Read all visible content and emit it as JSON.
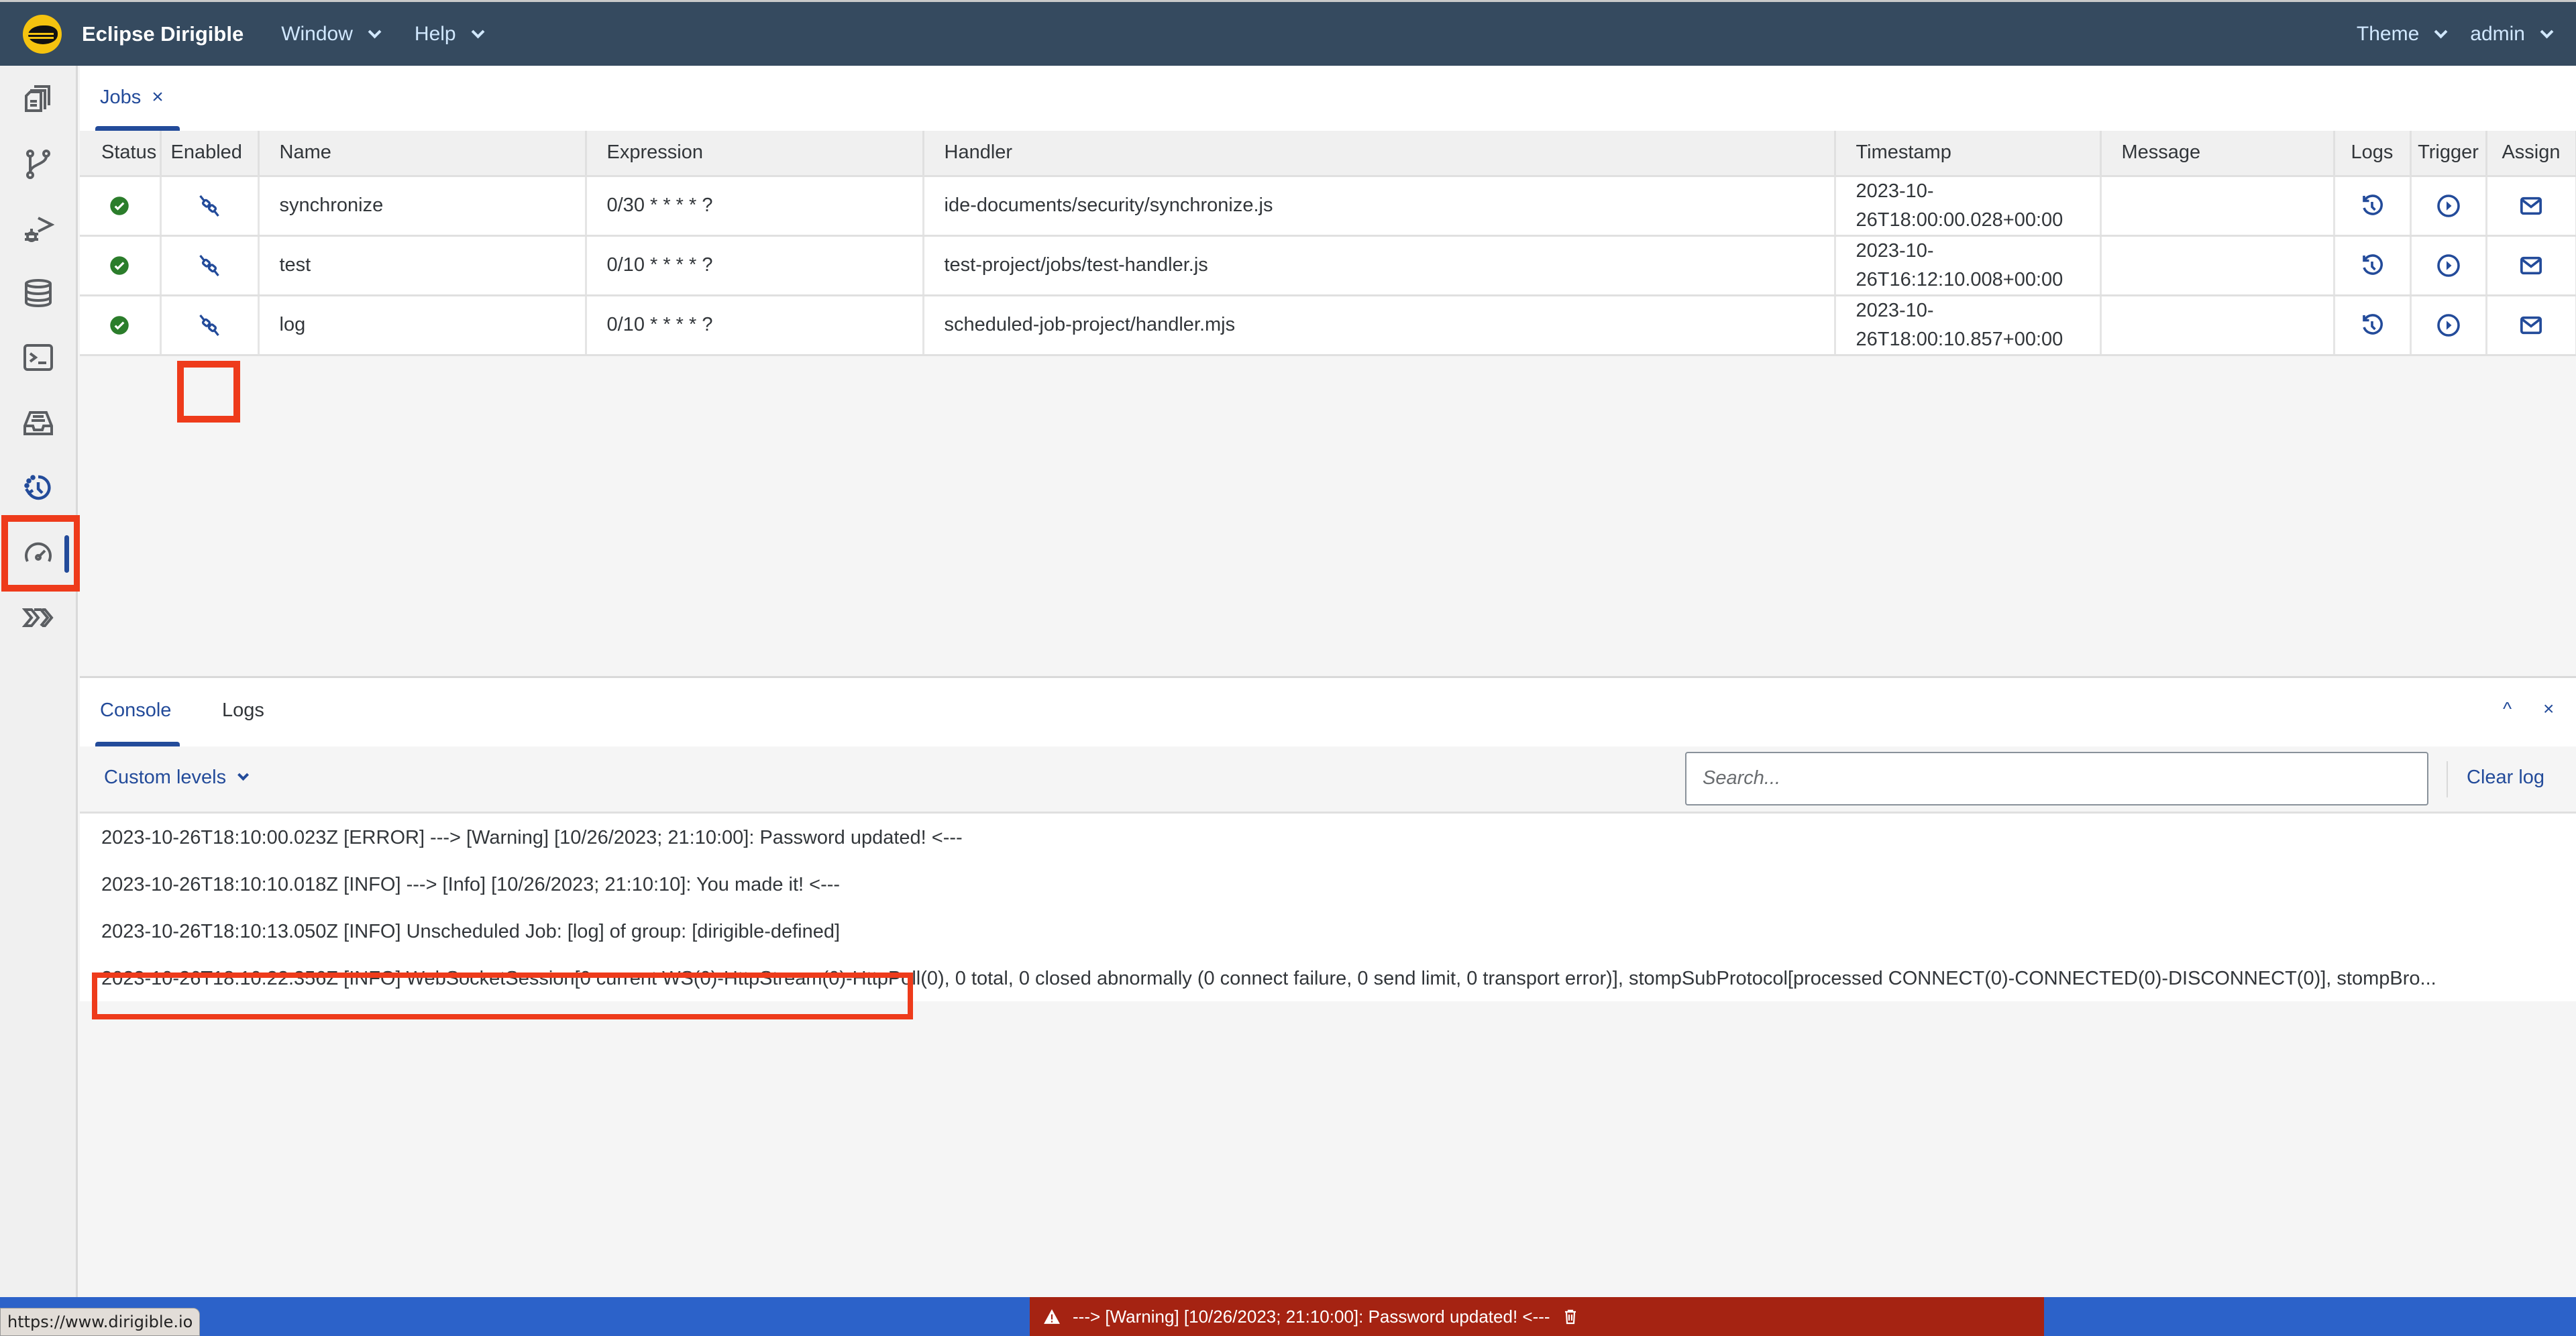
{
  "shell": {
    "brand": "Eclipse Dirigible",
    "menus": [
      "Window",
      "Help"
    ],
    "right_menus": [
      "Theme",
      "admin"
    ]
  },
  "sidebar": {
    "items": [
      {
        "name": "documents",
        "icon": "documents-icon"
      },
      {
        "name": "git",
        "icon": "git-branch-icon"
      },
      {
        "name": "debugger",
        "icon": "debug-icon"
      },
      {
        "name": "database",
        "icon": "database-icon"
      },
      {
        "name": "terminal",
        "icon": "terminal-icon"
      },
      {
        "name": "inbox",
        "icon": "inbox-icon"
      },
      {
        "name": "jobs",
        "icon": "scheduled-history-icon",
        "active": true
      },
      {
        "name": "monitoring",
        "icon": "speedometer-icon"
      },
      {
        "name": "operations",
        "icon": "chevrons-icon"
      }
    ]
  },
  "editor": {
    "tab": {
      "label": "Jobs",
      "close": "×"
    }
  },
  "jobs_table": {
    "columns": [
      "Status",
      "Enabled",
      "Name",
      "Expression",
      "Handler",
      "Timestamp",
      "Message",
      "Logs",
      "Trigger",
      "Assign"
    ],
    "rows": [
      {
        "status": "ok",
        "enabled_icon": "unplug-icon",
        "name": "synchronize",
        "expression": "0/30 * * * * ?",
        "handler": "ide-documents/security/synchronize.js",
        "timestamp": "2023-10-26T18:00:00.028+00:00",
        "message": ""
      },
      {
        "status": "ok",
        "enabled_icon": "unplug-icon",
        "name": "test",
        "expression": "0/10 * * * * ?",
        "handler": "test-project/jobs/test-handler.js",
        "timestamp": "2023-10-26T16:12:10.008+00:00",
        "message": ""
      },
      {
        "status": "ok",
        "enabled_icon": "unplug-icon",
        "name": "log",
        "expression": "0/10 * * * * ?",
        "handler": "scheduled-job-project/handler.mjs",
        "timestamp": "2023-10-26T18:00:10.857+00:00",
        "message": ""
      }
    ]
  },
  "bottom_panel": {
    "tabs": [
      "Console",
      "Logs"
    ],
    "active_tab": "Console",
    "collapse": "^",
    "close": "×",
    "levels_label": "Custom levels",
    "search_placeholder": "Search...",
    "clear_label": "Clear log",
    "lines": [
      "2023-10-26T18:10:00.023Z [ERROR] ---> [Warning] [10/26/2023; 21:10:00]: Password updated! <---",
      "2023-10-26T18:10:10.018Z [INFO] ---> [Info] [10/26/2023; 21:10:10]: You made it! <---",
      "2023-10-26T18:10:13.050Z [INFO] Unscheduled Job: [log] of group: [dirigible-defined]",
      "2023-10-26T18:10:22.356Z [INFO] WebSocketSession[0 current WS(0)-HttpStream(0)-HttpPoll(0), 0 total, 0 closed abnormally (0 connect failure, 0 send limit, 0 transport error)], stompSubProtocol[processed CONNECT(0)-CONNECTED(0)-DISCONNECT(0)], stompBro..."
    ]
  },
  "statusbar": {
    "url_tooltip": "https://www.dirigible.io",
    "warning": "---> [Warning] [10/26/2023; 21:10:00]: Password updated! <---"
  },
  "colors": {
    "shell": "#354a5f",
    "accent": "#234b9a",
    "success": "#2b7d2b",
    "status_bar": "#2c62c9",
    "warning_bar": "#a52312",
    "annotation": "#ee3b1b"
  }
}
